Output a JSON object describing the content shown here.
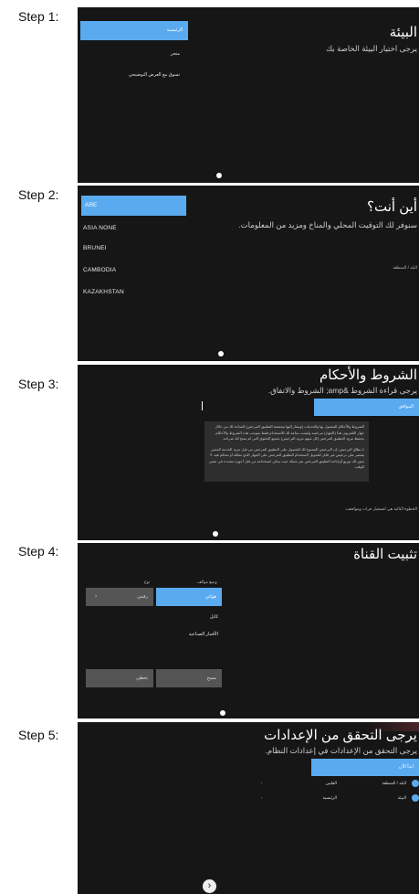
{
  "step_labels": [
    "Step 1:",
    "Step 2:",
    "Step 3:",
    "Step 4:",
    "Step 5:"
  ],
  "step1": {
    "title": "البيئة",
    "subtitle": "يرجى اختيار البيئة الخاصة بك",
    "options": [
      "الرئيسية",
      "متجر",
      "تسوق مع العرض التوضيحي"
    ]
  },
  "step2": {
    "title": "أين أنت؟",
    "subtitle": "سنوفر لك التوقيت المحلي والمناخ ومزيد من المعلومات.",
    "side_label": "البلد / المنطقة",
    "countries": [
      "ARE",
      "ASIA NONE",
      "BRUNEI",
      "CAMBODIA",
      "KAZAKHSTAN"
    ]
  },
  "step3": {
    "title": "الشروط والأحكام",
    "subtitle": "يرجى قراءة الشروط &amp; الشروط والاتفاق.",
    "button": "الموافق",
    "terms_paragraphs": [
      "الشروط والأحكام المعمول بها والخدمات (ويشار إليها مجتمعة التطبيق المرخص) المتاحة لك من خلال جهاز التلفزيون هذا (الجهاز) مرخصة وليست مباعة لك للاستخدام فقط بموجب هذه الشروط والأحكام. يحتفظ مزود التطبيق المرخص (كل منهم مزود الترخيص) بجميع الحقوق التي لم تمنح لك صراحة.",
      "1-نطاق الترخيص: إن الترخيص الممنوح لك للحصول على التطبيق المرخص من قبل مزود الخدمة المعني يقتصر على ترخيص غير قابل للتحويل لاستخدام التطبيق المرخص على الجهاز الذي تملكه أو تتحكم فيه. لا يجوز لك توزيع أو إتاحة التطبيق المرخص عبر شبكة حيث يمكن استخدامه من قبل أجهزة متعددة في نفس الوقت."
    ],
    "footer": "الخطوة التالية هي لتسجيل قرات وموافقت."
  },
  "step4": {
    "title": "تثبيت القناة",
    "col_labels": [
      "وضع موالف",
      "نوع"
    ],
    "tuner_options": [
      "هوائي",
      "كابل",
      "الأقمار الصناعية"
    ],
    "type_value": "رقمي",
    "buttons": [
      "مسح",
      "تخطي"
    ]
  },
  "step5": {
    "title": "يرجى التحقق من الإعدادات",
    "subtitle": "يرجى التحقق من الإعدادات في إعدادات النظام.",
    "button": "ابدأ الآن",
    "rows": [
      {
        "label": "البلد / المنطقة",
        "value": "الفلبين"
      },
      {
        "label": "البيئة",
        "value": "الرئيسية"
      }
    ],
    "accent": "#5aaaf0"
  }
}
